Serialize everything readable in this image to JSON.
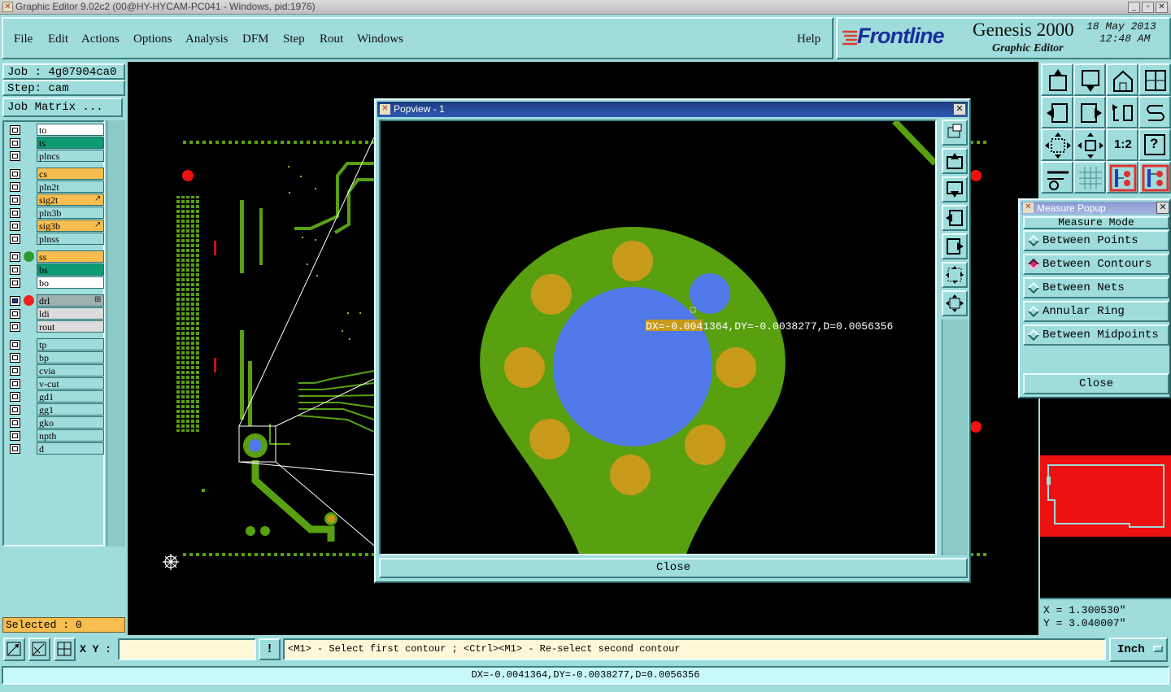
{
  "window": {
    "title": "Graphic Editor 9.02c2 (00@HY-HYCAM-PC041 - Windows, pid:1976)",
    "min": "_",
    "max": "▫",
    "close": "✕"
  },
  "menubar": {
    "items": [
      "File",
      "Edit",
      "Actions",
      "Options",
      "Analysis",
      "DFM",
      "Step",
      "Rout",
      "Windows"
    ],
    "help": "Help"
  },
  "logo": {
    "brand": "Frontline",
    "product": "Genesis 2000",
    "subtitle": "Graphic Editor",
    "date": "18 May 2013",
    "time": "12:48 AM"
  },
  "job": {
    "job_label": "Job : 4g07904ca0",
    "step_label": "Step: cam",
    "matrix_button": "Job Matrix ..."
  },
  "layers": [
    {
      "name": "to",
      "color": "#ffffff",
      "dot": ""
    },
    {
      "name": "ts",
      "color": "#0d9b73",
      "dot": ""
    },
    {
      "name": "plncs",
      "color": "#9fdcdc",
      "dot": ""
    },
    {
      "name": "cs",
      "color": "#f7bd4f",
      "dot": ""
    },
    {
      "name": "pln2t",
      "color": "#9fdcdc",
      "dot": ""
    },
    {
      "name": "sig2t",
      "color": "#f7bd4f",
      "dot": "",
      "mark": "↗"
    },
    {
      "name": "pln3b",
      "color": "#9fdcdc",
      "dot": ""
    },
    {
      "name": "sig3b",
      "color": "#f7bd4f",
      "dot": "",
      "mark": "↗"
    },
    {
      "name": "plnss",
      "color": "#9fdcdc",
      "dot": ""
    },
    {
      "name": "ss",
      "color": "#f7bd4f",
      "dot": "#2f9a2f"
    },
    {
      "name": "bs",
      "color": "#0d9b73",
      "dot": ""
    },
    {
      "name": "bo",
      "color": "#ffffff",
      "dot": ""
    },
    {
      "name": "drl",
      "color": "#9fb0b0",
      "dot": "#ee2222",
      "active": true,
      "mark": "⊞"
    },
    {
      "name": "ldi",
      "color": "#dcdcdc",
      "dot": ""
    },
    {
      "name": "rout",
      "color": "#dcdcdc",
      "dot": ""
    },
    {
      "name": "tp",
      "color": "#9fdcdc",
      "dot": ""
    },
    {
      "name": "bp",
      "color": "#9fdcdc",
      "dot": ""
    },
    {
      "name": "cvia",
      "color": "#9fdcdc",
      "dot": ""
    },
    {
      "name": "v-cut",
      "color": "#9fdcdc",
      "dot": ""
    },
    {
      "name": "gd1",
      "color": "#9fdcdc",
      "dot": ""
    },
    {
      "name": "gg1",
      "color": "#9fdcdc",
      "dot": ""
    },
    {
      "name": "gko",
      "color": "#9fdcdc",
      "dot": ""
    },
    {
      "name": "npth",
      "color": "#9fdcdc",
      "dot": ""
    },
    {
      "name": "d",
      "color": "#9fdcdc",
      "dot": ""
    }
  ],
  "selected_label": "Selected : 0",
  "popview": {
    "title": "Popview - 1",
    "close_label": "Close",
    "measure_text": "DX=-0.0041364,DY=-0.0038277,D=0.0056356"
  },
  "measure": {
    "title": "Measure Popup",
    "heading": "Measure Mode",
    "options": [
      "Between Points",
      "Between Contours",
      "Between Nets",
      "Annular Ring",
      "Between Midpoints"
    ],
    "selected": "Between Contours",
    "close_label": "Close"
  },
  "coords": {
    "x": "X = 1.300530\"",
    "y": "Y = 3.040007\""
  },
  "statusbar": {
    "xy_label": "X Y :",
    "xy_value": "",
    "excl": "!",
    "prompt": "<M1> - Select first contour ; <Ctrl><M1> - Re-select second contour",
    "units": "Inch"
  },
  "bottom_status": "DX=-0.0041364,DY=-0.0038277,D=0.0056356",
  "right_tools": [
    [
      "tool-up-icon",
      "tool-down-icon",
      "tool-home-icon",
      "tool-split-icon"
    ],
    [
      "tool-left-icon",
      "tool-right-icon",
      "tool-undo-icon",
      "tool-swap-icon"
    ],
    [
      "tool-fit-icon",
      "tool-center-icon",
      "tool-ratio-icon",
      "tool-help-icon"
    ],
    [
      "tool-tools-icon",
      "tool-grid-icon",
      "tool-layers-icon",
      "tool-layers2-icon"
    ]
  ],
  "ratio_label": "1:2",
  "help_glyph": "?"
}
